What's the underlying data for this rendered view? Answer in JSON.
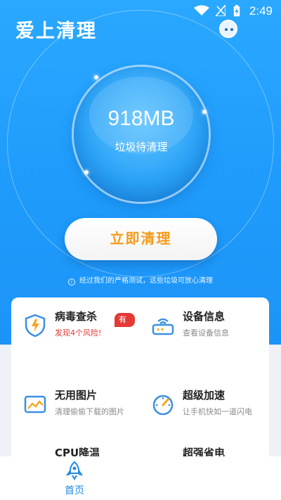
{
  "status_bar": {
    "time": "2:49"
  },
  "app": {
    "title": "爱上清理"
  },
  "junk": {
    "size": "918MB",
    "label": "垃圾待清理"
  },
  "actions": {
    "clean_label": "立即清理"
  },
  "notice": {
    "icon": "info-icon",
    "text": "经过我们的严格测试，这些垃圾可放心清理"
  },
  "features": [
    {
      "title": "病毒查杀",
      "subtitle": "发现4个风险!",
      "icon": "virus-shield-icon",
      "badge": "有风险"
    },
    {
      "title": "设备信息",
      "subtitle": "查看设备信息",
      "icon": "device-router-icon"
    },
    {
      "title": "无用图片",
      "subtitle": "清理偷偷下载的图片",
      "icon": "image-icon"
    },
    {
      "title": "超级加速",
      "subtitle": "让手机快如一道闪电",
      "icon": "speedometer-icon"
    },
    {
      "title": "CPU降温",
      "subtitle": "",
      "icon": "cpu-icon"
    },
    {
      "title": "超强省电",
      "subtitle": "",
      "icon": "battery-icon"
    }
  ],
  "tabbar": {
    "home_label": "首页"
  },
  "colors": {
    "primary": "#1e9bfb",
    "accent": "#f59a1a",
    "danger": "#e53935",
    "icon_blue": "#3d8fe0"
  }
}
